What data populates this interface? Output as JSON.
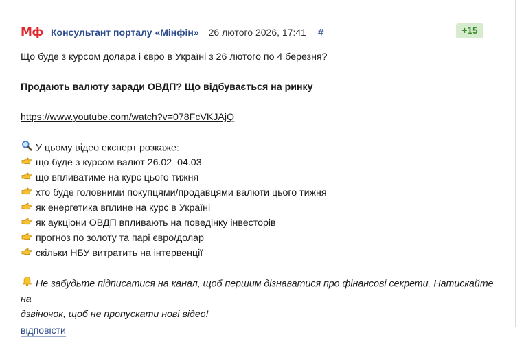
{
  "post": {
    "logo": "Мф",
    "author": "Консультант порталу «Мінфін»",
    "date": "26 лютого 2026, 17:41",
    "anchor": "#",
    "score": "+15",
    "question": "Що буде з курсом долара і євро в Україні з 26 лютого по 4 березня?",
    "headline": "Продають валюту заради ОВДП? Що відбувається на ринку",
    "video_url": "https://www.youtube.com/watch?v=078FcVKJAjQ",
    "intro": "У цьому відео експерт розкаже:",
    "bullets": [
      "що буде з курсом валют 26.02–04.03",
      "що впливатиме на курс цього тижня",
      "хто буде головними покупцями/продавцями валюти цього тижня",
      "як енергетика вплине на курс в Україні",
      "як аукціони ОВДП впливають на поведінку інвесторів",
      "прогноз по золоту та парі євро/долар",
      "скільки НБУ витратить на інтервенції"
    ],
    "closing_line1": "Не забудьте підписатися на канал, щоб першим дізнаватися про фінансові секрети. Натискайте на",
    "closing_line2": "дзвіночок, щоб не пропускати нові відео!",
    "reply_label": "відповісти"
  },
  "icons": {
    "intro": "magnifier-icon",
    "bullet": "pointing-hand-icon",
    "closing": "bell-icon"
  },
  "colors": {
    "logo": "#e0282e",
    "author": "#2b4a8c",
    "score_bg": "#d7eccf",
    "score_text": "#3b8a2e",
    "link": "#2b4a8c"
  }
}
